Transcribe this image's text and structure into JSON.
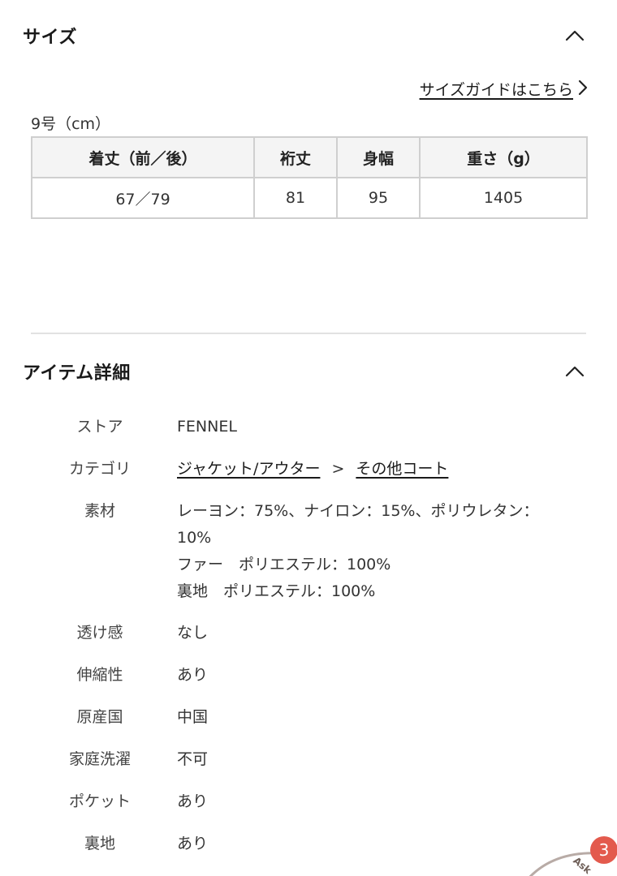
{
  "size_section": {
    "title": "サイズ",
    "size_guide_label": "サイズガイドはこちら",
    "unit_label": "9号（cm）",
    "table": {
      "headers": [
        "着丈（前／後）",
        "裄丈",
        "身幅",
        "重さ（g）"
      ],
      "rows": [
        [
          "67／79",
          "81",
          "95",
          "1405"
        ]
      ]
    }
  },
  "details_section": {
    "title": "アイテム詳細",
    "store": {
      "label": "ストア",
      "value": "FENNEL"
    },
    "category": {
      "label": "カテゴリ",
      "primary": "ジャケット/アウター",
      "separator": ">",
      "secondary": "その他コート"
    },
    "material": {
      "label": "素材",
      "lines": [
        "レーヨン：75%、ナイロン：15%、ポリウレタン：",
        "10%",
        "ファー　ポリエステル：100%",
        "裏地　ポリエステル：100%"
      ]
    },
    "sheerness": {
      "label": "透け感",
      "value": "なし"
    },
    "stretch": {
      "label": "伸縮性",
      "value": "あり"
    },
    "origin": {
      "label": "原産国",
      "value": "中国"
    },
    "washing": {
      "label": "家庭洗濯",
      "value": "不可"
    },
    "pocket": {
      "label": "ポケット",
      "value": "あり"
    },
    "lining": {
      "label": "裏地",
      "value": "あり"
    }
  },
  "chat_widget": {
    "badge_count": "3",
    "label": "Ask"
  },
  "colors": {
    "badge": "#e35a4d",
    "table_header_bg": "#f4f4f4",
    "border": "#cfcfcf"
  }
}
